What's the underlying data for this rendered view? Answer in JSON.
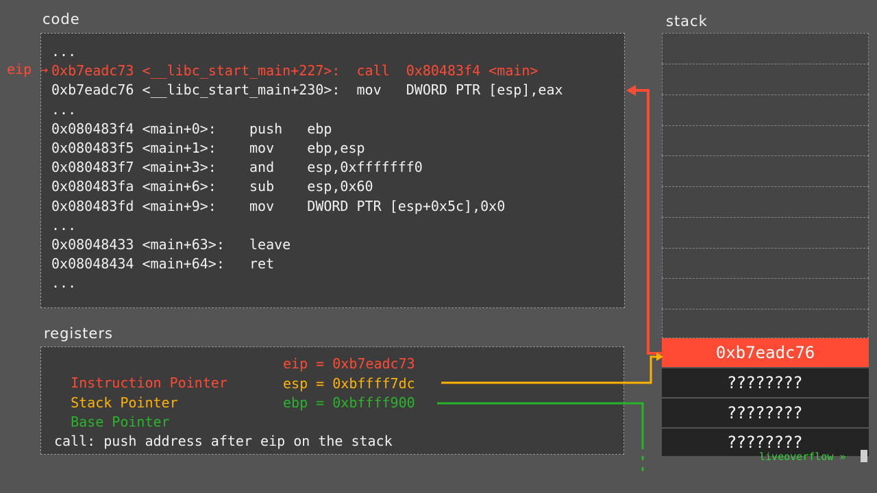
{
  "titles": {
    "code": "code",
    "registers": "registers",
    "stack": "stack"
  },
  "eip_marker": "eip →",
  "code": {
    "lines": [
      {
        "text": "...",
        "style": "normal"
      },
      {
        "text": "0xb7eadc73 <__libc_start_main+227>:  call  0x80483f4 <main>",
        "style": "highlight"
      },
      {
        "text": "0xb7eadc76 <__libc_start_main+230>:  mov   DWORD PTR [esp],eax",
        "style": "normal"
      },
      {
        "text": "...",
        "style": "normal"
      },
      {
        "text": "0x080483f4 <main+0>:    push   ebp",
        "style": "normal"
      },
      {
        "text": "0x080483f5 <main+1>:    mov    ebp,esp",
        "style": "normal"
      },
      {
        "text": "0x080483f7 <main+3>:    and    esp,0xfffffff0",
        "style": "normal"
      },
      {
        "text": "0x080483fa <main+6>:    sub    esp,0x60",
        "style": "normal"
      },
      {
        "text": "0x080483fd <main+9>:    mov    DWORD PTR [esp+0x5c],0x0",
        "style": "normal"
      },
      {
        "text": "...",
        "style": "normal"
      },
      {
        "text": "0x08048433 <main+63>:   leave",
        "style": "normal"
      },
      {
        "text": "0x08048434 <main+64>:   ret",
        "style": "normal"
      },
      {
        "text": "...",
        "style": "normal"
      }
    ]
  },
  "registers": {
    "rows": [
      {
        "name": "Instruction Pointer",
        "value": "eip = 0xb7eadc73",
        "color": "#ff4b33"
      },
      {
        "name": "Stack Pointer",
        "value": "esp = 0xbffff7dc",
        "color": "#ffb300"
      },
      {
        "name": "Base Pointer",
        "value": "ebp = 0xbffff900",
        "color": "#29b529"
      }
    ],
    "note": "call: push address after eip on the stack"
  },
  "stack": {
    "active_value": "0xb7eadc76",
    "unknown_values": [
      "????????",
      "????????",
      "????????"
    ]
  },
  "watermark": "liveoverflow »",
  "colors": {
    "eip": "#ff4b33",
    "esp": "#ffb300",
    "ebp": "#29b529"
  }
}
